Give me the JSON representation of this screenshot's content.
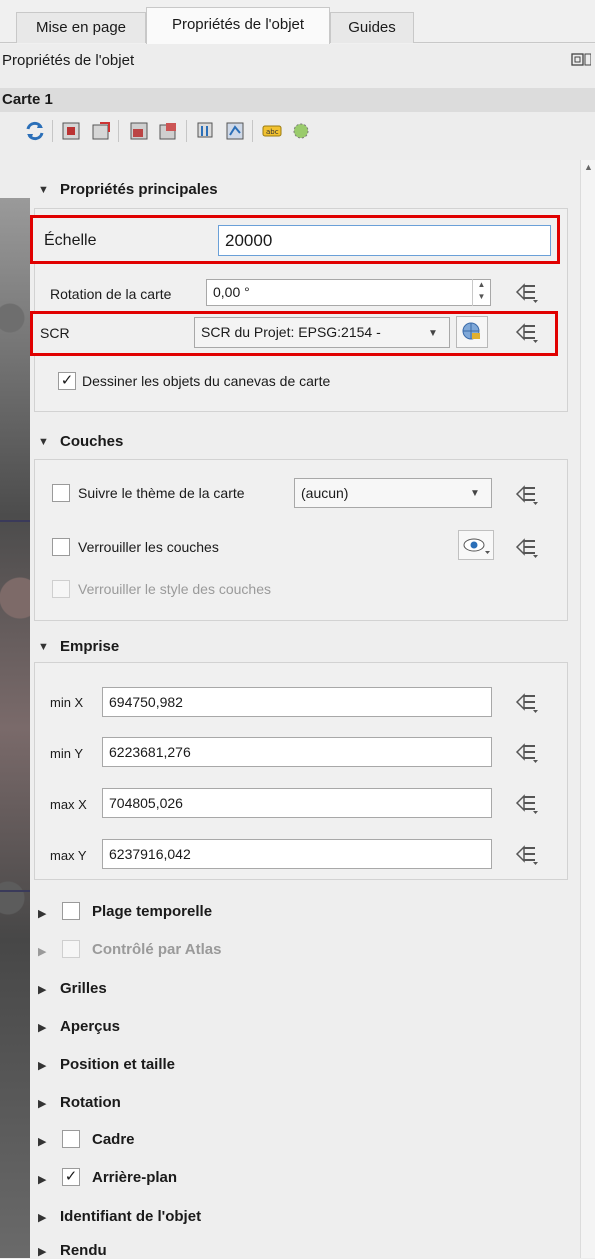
{
  "tabs": [
    "Mise en page",
    "Propriétés de l'objet",
    "Guides"
  ],
  "panel_title": "Propriétés de l'objet",
  "item_title": "Carte 1",
  "main_props": {
    "header": "Propriétés principales",
    "scale_label": "Échelle",
    "scale_value": "20000",
    "rotation_label": "Rotation de la carte",
    "rotation_value": "0,00 °",
    "crs_label": "SCR",
    "crs_value": "SCR du Projet: EPSG:2154 -",
    "draw_objects_label": "Dessiner les objets du canevas de carte"
  },
  "layers": {
    "header": "Couches",
    "follow_theme_label": "Suivre le thème de la carte",
    "theme_value": "(aucun)",
    "lock_layers_label": "Verrouiller les couches",
    "lock_styles_label": "Verrouiller le style des couches"
  },
  "extent": {
    "header": "Emprise",
    "rows": [
      {
        "label": "min X",
        "value": "694750,982"
      },
      {
        "label": "min Y",
        "value": "6223681,276"
      },
      {
        "label": "max X",
        "value": "704805,026"
      },
      {
        "label": "max Y",
        "value": "6237916,042"
      }
    ]
  },
  "collapsed_sections": {
    "temporal": "Plage temporelle",
    "atlas": "Contrôlé par Atlas",
    "grids": "Grilles",
    "overviews": "Aperçus",
    "position": "Position et taille",
    "rotation": "Rotation",
    "frame": "Cadre",
    "background": "Arrière-plan",
    "item_id": "Identifiant de l'objet",
    "rendering": "Rendu"
  },
  "checks": {
    "checked": "✓"
  },
  "colors": {
    "highlight": "#e00000",
    "selected_tab": "#fafafa"
  }
}
